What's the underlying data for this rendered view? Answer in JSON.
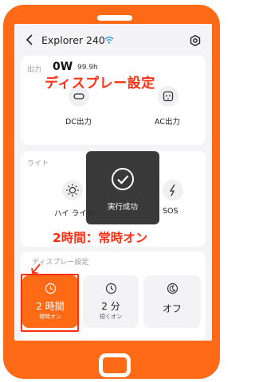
{
  "header": {
    "title": "Explorer 240"
  },
  "output": {
    "section_label": "出力",
    "power": "0W",
    "time": "99.9h",
    "ports": [
      {
        "label": "DC出力",
        "icon": "usb-c-port-icon"
      },
      {
        "label": "AC出力",
        "icon": "ac-outlet-icon"
      }
    ]
  },
  "overlays": {
    "title": "ディスプレー設定",
    "caption": "2時間：常時オン"
  },
  "light": {
    "section_label": "ライト",
    "options": [
      {
        "label": "ハイ ライト"
      },
      {
        "label": "SOS"
      }
    ]
  },
  "toast": {
    "text": "実行成功"
  },
  "display": {
    "section_label": "ディスプレー設定",
    "options": [
      {
        "main": "2 時間",
        "sub": "常時オン",
        "icon": "clock-icon"
      },
      {
        "main": "2 分",
        "sub": "短くオン",
        "icon": "clock-icon"
      },
      {
        "main": "オフ",
        "sub": "",
        "icon": "moon-icon"
      }
    ]
  },
  "colors": {
    "accent": "#ff6a16",
    "overlay_text": "#ff2d12"
  }
}
